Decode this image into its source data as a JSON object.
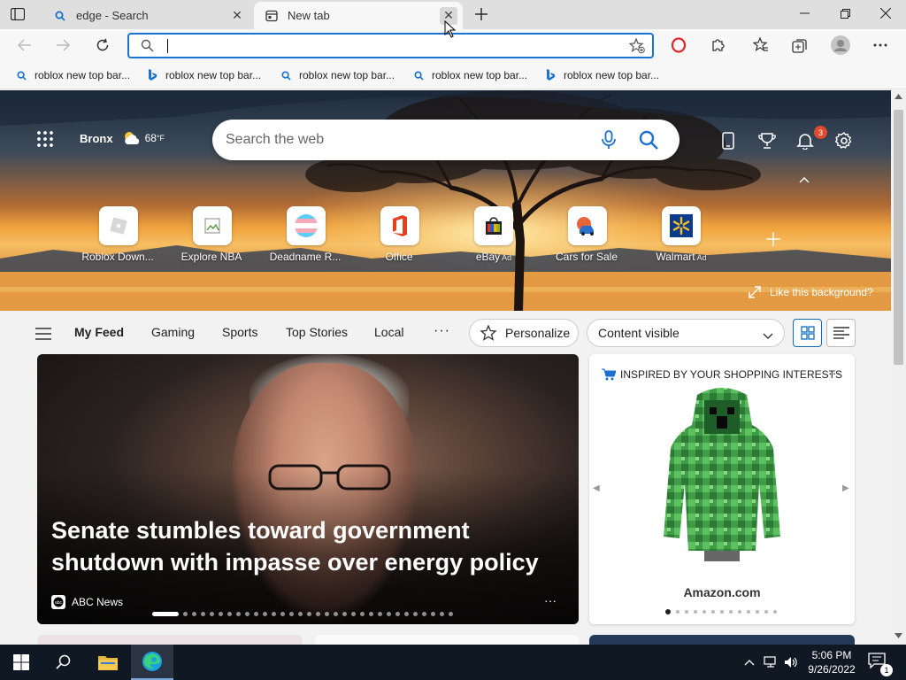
{
  "browser": {
    "tabs": [
      {
        "title": "edge - Search",
        "favicon": "search-icon",
        "active": false
      },
      {
        "title": "New tab",
        "favicon": "newtab-icon",
        "active": true
      }
    ],
    "address": {
      "value": "",
      "placeholder": ""
    }
  },
  "favorites": [
    {
      "label": "roblox new top bar...",
      "icon": "search-icon"
    },
    {
      "label": "roblox new top bar...",
      "icon": "bing-icon"
    },
    {
      "label": "roblox new top bar...",
      "icon": "search-icon"
    },
    {
      "label": "roblox new top bar...",
      "icon": "search-icon"
    },
    {
      "label": "roblox new top bar...",
      "icon": "bing-icon"
    }
  ],
  "newtab": {
    "weather": {
      "city": "Bronx",
      "temp": "68",
      "unit": "°F"
    },
    "search_placeholder": "Search the web",
    "notification_count": "3",
    "quicklinks": [
      {
        "label": "Roblox Down...",
        "ad": ""
      },
      {
        "label": "Explore NBA",
        "ad": ""
      },
      {
        "label": "Deadname R...",
        "ad": ""
      },
      {
        "label": "Office",
        "ad": ""
      },
      {
        "label": "eBay",
        "ad": "Ad"
      },
      {
        "label": "Cars for Sale",
        "ad": ""
      },
      {
        "label": "Walmart",
        "ad": "Ad"
      }
    ],
    "like_background": "Like this background?"
  },
  "feed": {
    "nav": [
      "My Feed",
      "Gaming",
      "Sports",
      "Top Stories",
      "Local"
    ],
    "personalize": "Personalize",
    "content_visibility": "Content visible",
    "main_story": {
      "headline": "Senate stumbles toward government shutdown with impasse over energy policy",
      "source": "ABC News",
      "slide_count": 32,
      "current_slide": 1
    },
    "shopping": {
      "header": "INSPIRED BY YOUR SHOPPING INTERESTS",
      "store": "Amazon.com",
      "slide_count": 13,
      "current_slide": 1
    }
  },
  "taskbar": {
    "time": "5:06 PM",
    "date": "9/26/2022",
    "notification_count": "1"
  },
  "colors": {
    "accent": "#0f6cbd",
    "badge": "#e0492e",
    "taskbar": "#101824"
  }
}
